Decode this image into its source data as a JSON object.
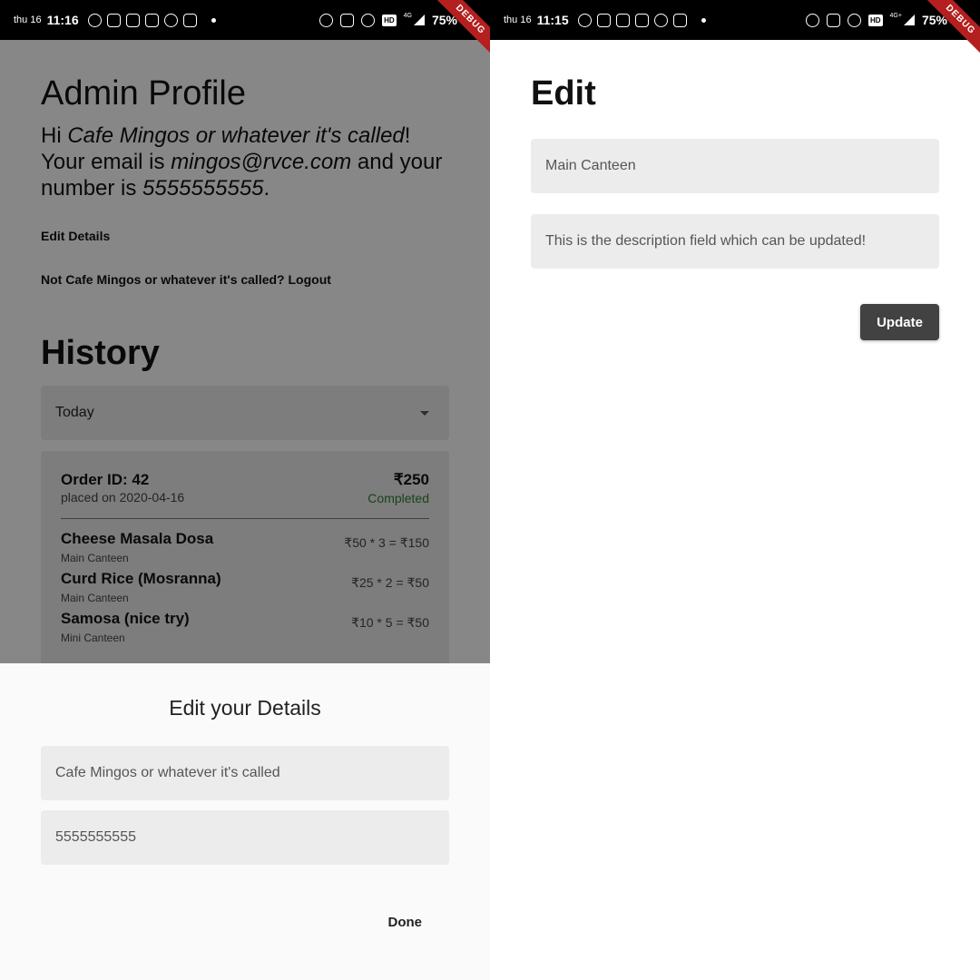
{
  "left_screen": {
    "status_bar": {
      "day": "thu 16",
      "time": "11:16",
      "network": "4G",
      "battery": "75%"
    },
    "debug_banner": "DEBUG",
    "profile": {
      "title": "Admin Profile",
      "greeting_prefix": "Hi ",
      "cafe_name": "Cafe Mingos or whatever it's called",
      "greeting_mid": "! Your email is ",
      "email": "mingos@rvce.com",
      "greeting_phone": " and your number is ",
      "phone": "5555555555",
      "greeting_end": ".",
      "edit_details": "Edit Details",
      "logout_line": "Not Cafe Mingos or whatever it's called? Logout"
    },
    "history": {
      "title": "History",
      "filter_selected": "Today",
      "order": {
        "id_label": "Order ID: 42",
        "date": "placed on 2020-04-16",
        "total": "₹250",
        "status": "Completed",
        "items": [
          {
            "name": "Cheese Masala Dosa",
            "location": "Main Canteen",
            "price": "₹50 * 3 = ₹150"
          },
          {
            "name": "Curd Rice (Mosranna)",
            "location": "Main Canteen",
            "price": "₹25 * 2 = ₹50"
          },
          {
            "name": "Samosa (nice try)",
            "location": "Mini Canteen",
            "price": "₹10 * 5 = ₹50"
          }
        ]
      }
    },
    "sheet": {
      "title": "Edit your Details",
      "name_value": "Cafe Mingos or whatever it's called",
      "phone_value": "5555555555",
      "done_label": "Done"
    }
  },
  "right_screen": {
    "status_bar": {
      "day": "thu 16",
      "time": "11:15",
      "network": "4G+",
      "battery": "75%"
    },
    "debug_banner": "DEBUG",
    "title": "Edit",
    "name_value": "Main Canteen",
    "description_value": "This is the description field which can be updated!",
    "update_label": "Update"
  },
  "colors": {
    "status_bar": "#000000",
    "field_bg": "#ececec",
    "completed": "#2e7d32",
    "update_button": "#424242",
    "debug_banner": "#b41f1f"
  },
  "icons": [
    "whatsapp-icon",
    "instagram-icon",
    "calendar-icon",
    "bowl-icon",
    "gmail-icon",
    "alarm-icon",
    "vibrate-icon",
    "hotspot-icon",
    "hd-icon",
    "signal-icon",
    "caret-down-icon"
  ]
}
